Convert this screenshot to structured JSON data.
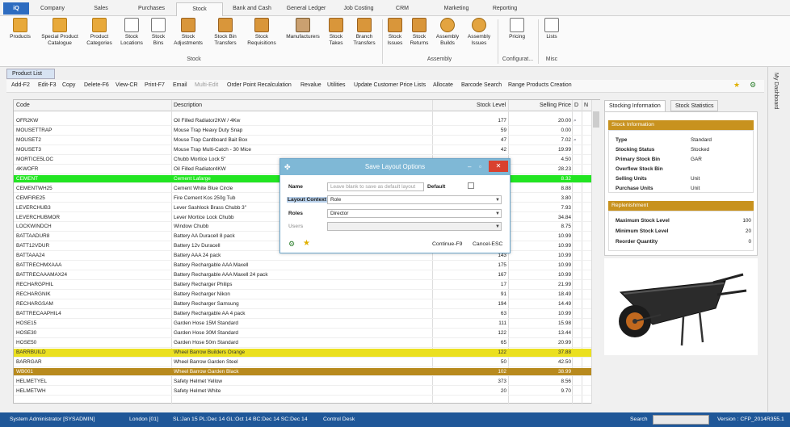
{
  "app": {
    "logo": "iQ"
  },
  "ribbon_tabs": [
    "Company",
    "Sales",
    "Purchases",
    "Stock",
    "Bank and Cash",
    "General Ledger",
    "Job Costing",
    "CRM",
    "Marketing",
    "Reporting"
  ],
  "active_tab": "Stock",
  "ribbon_buttons": [
    {
      "label": "Products",
      "icon": "folder-icon"
    },
    {
      "label": "Special Product Catalogue",
      "icon": "folder-icon"
    },
    {
      "label": "Product Categories",
      "icon": "folder-icon"
    },
    {
      "label": "Stock Locations",
      "icon": "doc-icon"
    },
    {
      "label": "Stock Bins",
      "icon": "doc-icon"
    },
    {
      "label": "Stock Adjustments",
      "icon": "box-icon"
    },
    {
      "label": "Stock Bin Transfers",
      "icon": "box-icon"
    },
    {
      "label": "Stock Requisitions",
      "icon": "box-icon"
    },
    {
      "label": "Manufacturers",
      "icon": "people-icon"
    },
    {
      "label": "Stock Takes",
      "icon": "box-icon"
    },
    {
      "label": "Branch Transfers",
      "icon": "box-icon"
    },
    {
      "label": "Stock Issues",
      "icon": "box-icon"
    },
    {
      "label": "Stock Returns",
      "icon": "box-icon"
    },
    {
      "label": "Assembly Builds",
      "icon": "gear-icon"
    },
    {
      "label": "Assembly Issues",
      "icon": "gear-icon"
    },
    {
      "label": "Pricing",
      "icon": "doc-icon"
    },
    {
      "label": "Lists",
      "icon": "doc-icon"
    }
  ],
  "ribbon_groups": [
    "Stock",
    "Assembly",
    "Configurat...",
    "Misc"
  ],
  "doc_tab": "Product List",
  "side_label": "My Dashboard",
  "toolbar": [
    "Add-F2",
    "Edit-F3",
    "Copy",
    "Delete-F6",
    "View-CR",
    "Print-F7",
    "Email",
    "Multi-Edit",
    "Order Point Recalculation",
    "Revalue",
    "Utilities",
    "Update Customer Price Lists",
    "Allocate",
    "Barcode Search",
    "Range Products Creation"
  ],
  "grid": {
    "columns": [
      "Code",
      "Description",
      "Stock Level",
      "Selling Price",
      "D",
      "N"
    ],
    "rows": [
      {
        "code": "OFR2KW",
        "desc": "Oil Filled Radiator2KW / 4Kw",
        "level": "177",
        "price": "20.00",
        "clip": true
      },
      {
        "code": "MOUSETTRAP",
        "desc": "Mouse Trap Heavy Duty Snap",
        "level": "59",
        "price": "0.00"
      },
      {
        "code": "MOUSET2",
        "desc": "Mouse Trap Cardboard Bait Box",
        "level": "47",
        "price": "7.02",
        "clip": true
      },
      {
        "code": "MOUSET3",
        "desc": "Mouse Trap Multi-Catch - 30 Mice",
        "level": "42",
        "price": "19.99"
      },
      {
        "code": "MORTICE5LOC",
        "desc": "Chubb Mortice Lock 5\"",
        "level": "",
        "price": "4.50"
      },
      {
        "code": "4KWOFR",
        "desc": "Oil Filled Radiator4KW",
        "level": "",
        "price": "28.23"
      },
      {
        "code": "CEMENT",
        "desc": "Cement Lafarge",
        "level": "",
        "price": "8.32",
        "hl": "green"
      },
      {
        "code": "CEMENTWH25",
        "desc": "Cement White Blue Circle",
        "level": "",
        "price": "8.88"
      },
      {
        "code": "CEMFIRE25",
        "desc": "Fire Cement Kos 250g Tub",
        "level": "",
        "price": "3.80"
      },
      {
        "code": "LEVERCHUB3",
        "desc": "Lever Sashlock Brass Chubb 3\"",
        "level": "",
        "price": "7.93"
      },
      {
        "code": "LEVERCHUBMOR",
        "desc": "Lever Mortice Lock Chubb",
        "level": "",
        "price": "34.84"
      },
      {
        "code": "LOCKWINDCH",
        "desc": "Window Chubb",
        "level": "",
        "price": "8.75"
      },
      {
        "code": "BATTAADUR8",
        "desc": "Battery AA Duracell 8 pack",
        "level": "",
        "price": "10.99"
      },
      {
        "code": "BATT12VDUR",
        "desc": "Battery 12v Duracell",
        "level": "",
        "price": "10.99"
      },
      {
        "code": "BATTAAA24",
        "desc": "Battery AAA 24 pack",
        "level": "143",
        "price": "10.99"
      },
      {
        "code": "BATTRECHMXAAA",
        "desc": "Battery Rechargable AAA Maxell",
        "level": "175",
        "price": "10.99"
      },
      {
        "code": "BATTRECAAAMAX24",
        "desc": "Battery Rechargable AAA Maxell 24 pack",
        "level": "167",
        "price": "10.99"
      },
      {
        "code": "RECHARGPHIL",
        "desc": "Battery Recharger Philips",
        "level": "17",
        "price": "21.99"
      },
      {
        "code": "RECHARGNIK",
        "desc": "Battery Recharger Nikon",
        "level": "91",
        "price": "18.49"
      },
      {
        "code": "RECHARGSAM",
        "desc": "Battery Recharger Samsung",
        "level": "194",
        "price": "14.49"
      },
      {
        "code": "BATTRECAAPHIL4",
        "desc": "Battery Rechargable AA 4 pack",
        "level": "63",
        "price": "10.99"
      },
      {
        "code": "HOSE15",
        "desc": "Garden Hose 15M Standard",
        "level": "111",
        "price": "15.98"
      },
      {
        "code": "HOSE30",
        "desc": "Garden Hose 30M Standard",
        "level": "122",
        "price": "13.44"
      },
      {
        "code": "HOSE50",
        "desc": "Garden Hose 50m Standard",
        "level": "65",
        "price": "20.99"
      },
      {
        "code": "BARRBUILD",
        "desc": "Wheel Barrow Builders Orange",
        "level": "122",
        "price": "37.88",
        "hl": "yellow"
      },
      {
        "code": "BARRGAR",
        "desc": "Wheel Barrow Garden Steel",
        "level": "50",
        "price": "42.50"
      },
      {
        "code": "WB001",
        "desc": "Wheel Barrow Garden Black",
        "level": "102",
        "price": "38.99",
        "hl": "brown"
      },
      {
        "code": "HELMETYEL",
        "desc": "Safety Helmet Yellow",
        "level": "373",
        "price": "8.56"
      },
      {
        "code": "HELMETWH",
        "desc": "Safety Helmet White",
        "level": "20",
        "price": "9.70"
      }
    ]
  },
  "side_tabs": [
    "Stocking Information",
    "Stock Statistics"
  ],
  "stock_info": {
    "title": "Stock Information",
    "rows": [
      {
        "k": "Type",
        "v": "Standard"
      },
      {
        "k": "Stocking Status",
        "v": "Stocked"
      },
      {
        "k": "Primary Stock Bin",
        "v": "GAR"
      },
      {
        "k": "Overflow Stock Bin",
        "v": ""
      },
      {
        "k": "Selling Units",
        "v": "Unit"
      },
      {
        "k": "Purchase Units",
        "v": "Unit"
      }
    ]
  },
  "replenishment": {
    "title": "Replenishment",
    "rows": [
      {
        "k": "Maximum Stock Level",
        "v": "100"
      },
      {
        "k": "Minimum Stock Level",
        "v": "20"
      },
      {
        "k": "Reorder Quantity",
        "v": "0"
      }
    ]
  },
  "dialog": {
    "title": "Save Layout Options",
    "name_label": "Name",
    "name_placeholder": "Leave blank to save as default layout",
    "default_label": "Default",
    "context_label": "Layout Context",
    "context_value": "Role",
    "roles_label": "Roles",
    "roles_value": "Director",
    "users_label": "Users",
    "continue_label": "Continue-F9",
    "cancel_label": "Cancel-ESC"
  },
  "status": {
    "user": "System Administrator [SYSADMIN]",
    "branch": "London [01]",
    "periods": "SL:Jan 15  PL:Dec 14  GL:Oct 14  BC:Dec 14  SC:Dec 14",
    "control": "Control Desk",
    "search": "Search",
    "version": "Version : CFP_2014R355.1"
  },
  "colors": {
    "accent": "#2d6cc0",
    "green_row": "#22e522",
    "yellow_row": "#ebe020",
    "brown_row": "#b88a1e",
    "section": "#c8921e"
  }
}
